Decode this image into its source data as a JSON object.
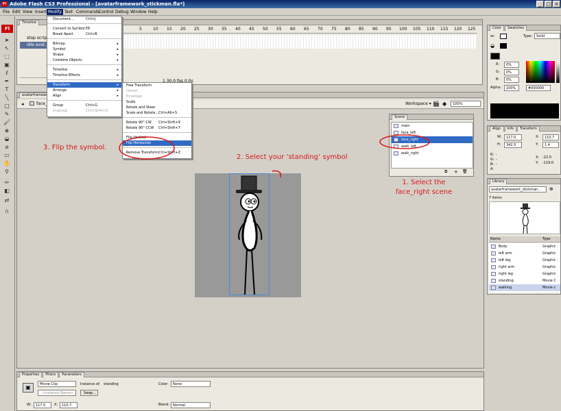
{
  "app": {
    "title": "Adobe Flash CS3 Professional - [avatarframework_stickman.fla*]",
    "window_buttons": [
      "_",
      "□",
      "×"
    ]
  },
  "menubar": [
    "File",
    "Edit",
    "View",
    "Insert",
    "Modify",
    "Text",
    "Commands",
    "Control",
    "Debug",
    "Window",
    "Help"
  ],
  "timeline": {
    "tab": "Timeline",
    "frame_numbers": [
      "5",
      "10",
      "15",
      "20",
      "25",
      "30",
      "35",
      "40",
      "45",
      "50",
      "55",
      "60",
      "65",
      "70",
      "75",
      "80",
      "85",
      "90",
      "95",
      "100",
      "105",
      "110",
      "115",
      "120",
      "125"
    ],
    "layers": [
      "stop script",
      "idle avat..."
    ],
    "status": "1  30.0 fps  0.0s"
  },
  "modify_menu": {
    "items": [
      {
        "label": "Document...",
        "shortcut": "Ctrl+J"
      },
      {
        "label": "Convert to Symbol...",
        "shortcut": "F8"
      },
      {
        "label": "Break Apart",
        "shortcut": "Ctrl+B"
      },
      {
        "label": "Bitmap",
        "shortcut": ""
      },
      {
        "label": "Symbol",
        "shortcut": ""
      },
      {
        "label": "Shape",
        "shortcut": ""
      },
      {
        "label": "Combine Objects",
        "shortcut": ""
      },
      {
        "label": "Timeline",
        "shortcut": ""
      },
      {
        "label": "Timeline Effects",
        "shortcut": ""
      },
      {
        "label": "Transform",
        "shortcut": ""
      },
      {
        "label": "Arrange",
        "shortcut": ""
      },
      {
        "label": "Align",
        "shortcut": ""
      },
      {
        "label": "Group",
        "shortcut": "Ctrl+G"
      },
      {
        "label": "Ungroup",
        "shortcut": "Ctrl+Shift+G"
      }
    ]
  },
  "transform_menu": {
    "items": [
      {
        "label": "Free Transform",
        "shortcut": ""
      },
      {
        "label": "Distort",
        "shortcut": ""
      },
      {
        "label": "Envelope",
        "shortcut": ""
      },
      {
        "label": "Scale",
        "shortcut": ""
      },
      {
        "label": "Rotate and Skew",
        "shortcut": ""
      },
      {
        "label": "Scale and Rotate...",
        "shortcut": "Ctrl+Alt+S"
      },
      {
        "label": "Rotate 90° CW",
        "shortcut": "Ctrl+Shift+9"
      },
      {
        "label": "Rotate 90° CCW",
        "shortcut": "Ctrl+Shift+7"
      },
      {
        "label": "Flip Vertical",
        "shortcut": ""
      },
      {
        "label": "Flip Horizontal",
        "shortcut": ""
      },
      {
        "label": "Remove Transform",
        "shortcut": "Ctrl+Shift+Z"
      }
    ]
  },
  "document": {
    "tab": "avatarframework_stickman.fla*",
    "breadcrumb": "face_right",
    "workspace": "Workspace ▾",
    "zoom": "100%"
  },
  "scene_panel": {
    "tab": "Scene",
    "scenes": [
      "main",
      "face_left",
      "face_right",
      "walk_left",
      "walk_right"
    ],
    "selected": "face_right"
  },
  "annotations": {
    "step1": "1. Select the face_right scene",
    "step2": "2. Select your ‘standing’ symbol",
    "step3": "3. Flip the symbol."
  },
  "color_panel": {
    "tabs": [
      "Color",
      "Swatches"
    ],
    "type_label": "Type:",
    "type_value": "Solid",
    "r_label": "R:",
    "r": "0%",
    "g_label": "G:",
    "g": "0%",
    "b_label": "B:",
    "b": "0%",
    "alpha_label": "Alpha:",
    "alpha": "100%",
    "hex": "#000000"
  },
  "info_panel": {
    "tabs": [
      "Align",
      "Info",
      "Transform"
    ],
    "w_label": "W:",
    "w": "117.0",
    "x_label": "X:",
    "x": "110.7",
    "h_label": "H:",
    "h": "342.5",
    "y_label": "Y:",
    "y": "1.4",
    "r_label": "R:",
    "r_val": "-",
    "g_label": "G:",
    "g_val": "-",
    "b_label": "B:",
    "b_val": "-",
    "a_label": "A:",
    "a_val": "",
    "cx_label": "X:",
    "cx": "-22.0",
    "cy_label": "Y:",
    "cy": "-119.0"
  },
  "library": {
    "tab": "Library",
    "file": "avatarframework_stickman...",
    "count": "7 items",
    "col_name": "Name",
    "col_type": "Type",
    "items": [
      {
        "name": "Body",
        "type": "Graphic"
      },
      {
        "name": "left arm",
        "type": "Graphic"
      },
      {
        "name": "left leg",
        "type": "Graphic"
      },
      {
        "name": "right arm",
        "type": "Graphic"
      },
      {
        "name": "right leg",
        "type": "Graphic"
      },
      {
        "name": "standing",
        "type": "Movie C"
      },
      {
        "name": "walking",
        "type": "Movie c"
      }
    ]
  },
  "properties": {
    "tabs": [
      "Properties",
      "Filters",
      "Parameters"
    ],
    "symbol_type": "Movie Clip",
    "instance_of_label": "Instance of:",
    "instance_of": "standing",
    "instance_name_placeholder": "<Instance Name>",
    "swap": "Swap...",
    "color_label": "Color:",
    "color_value": "None",
    "w_label": "W:",
    "w": "117.0",
    "x_label": "X:",
    "x": "110.7",
    "blend_label": "Blend:",
    "blend_value": "Normal"
  }
}
